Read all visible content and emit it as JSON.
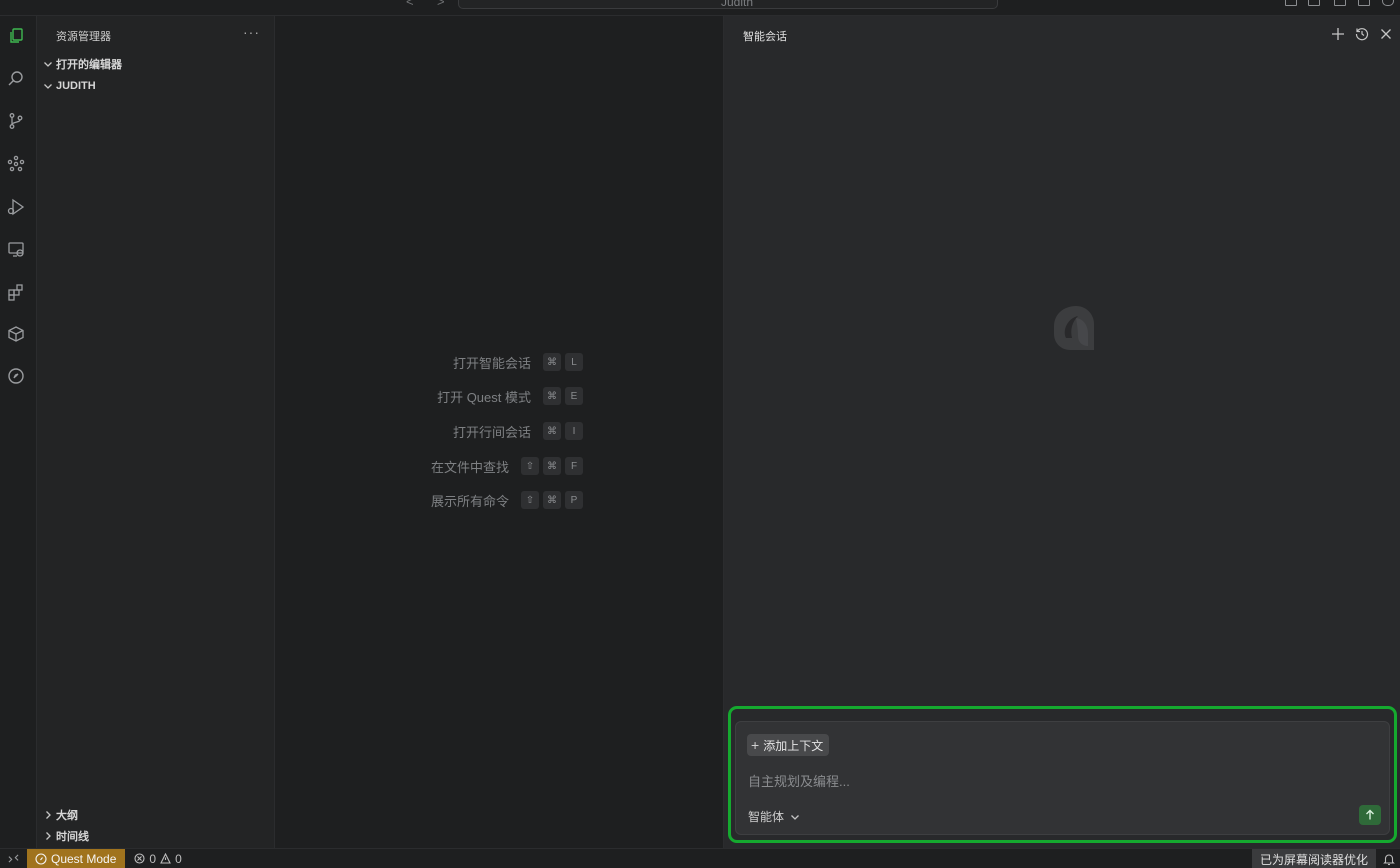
{
  "titlebar": {
    "back": "<",
    "forward": ">",
    "search_text": "Judith"
  },
  "sidebar": {
    "title": "资源管理器",
    "more": "···",
    "sections": [
      {
        "label": "打开的编辑器",
        "expanded": true
      },
      {
        "label": "JUDITH",
        "expanded": true
      }
    ],
    "bottom_sections": [
      {
        "label": "大纲",
        "expanded": false
      },
      {
        "label": "时间线",
        "expanded": false
      }
    ]
  },
  "editor": {
    "shortcuts": [
      {
        "label": "打开智能会话",
        "keys": [
          "⌘",
          "L"
        ]
      },
      {
        "label": "打开 Quest 模式",
        "keys": [
          "⌘",
          "E"
        ]
      },
      {
        "label": "打开行间会话",
        "keys": [
          "⌘",
          "I"
        ]
      },
      {
        "label": "在文件中查找",
        "keys": [
          "⇧",
          "⌘",
          "F"
        ]
      },
      {
        "label": "展示所有命令",
        "keys": [
          "⇧",
          "⌘",
          "P"
        ]
      }
    ]
  },
  "chat": {
    "title": "智能会话",
    "add_context": "添加上下文",
    "placeholder": "自主规划及编程...",
    "agent_mode": "智能体",
    "highlight_color": "#15a92f"
  },
  "statusbar": {
    "quest_mode": "Quest Mode",
    "errors": "0",
    "warnings": "0",
    "screen_reader": "已为屏幕阅读器优化",
    "accent": "#a0731d"
  },
  "colors": {
    "active_icon": "#3fb950",
    "send_button": "#2f6a39"
  }
}
